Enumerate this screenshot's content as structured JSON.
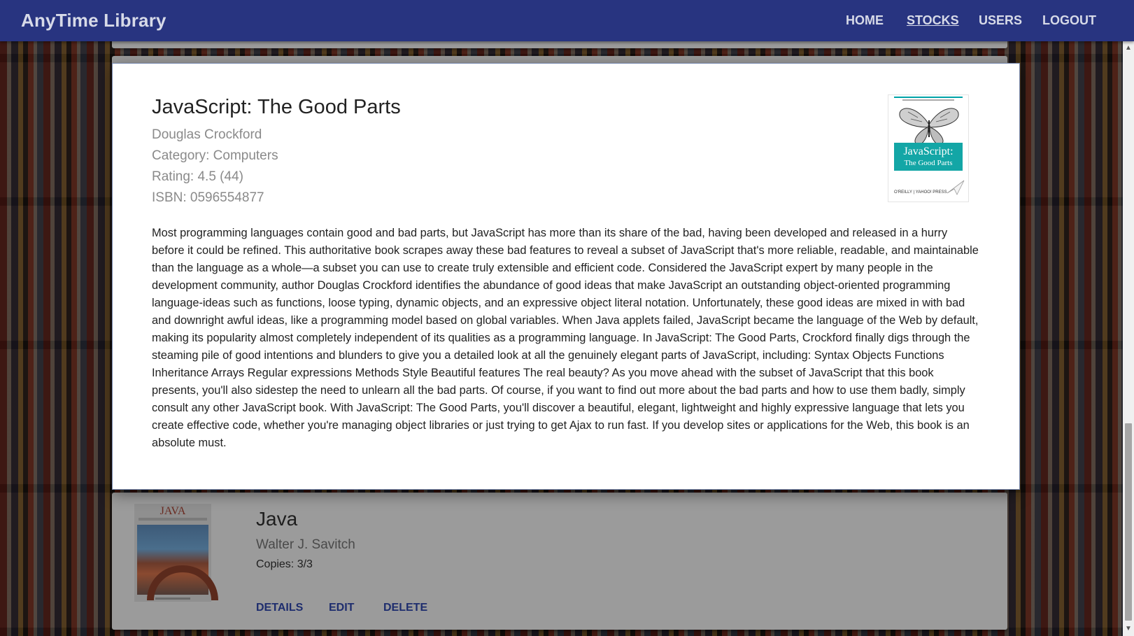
{
  "app": {
    "title": "AnyTime Library"
  },
  "nav": {
    "home": "HOME",
    "stocks": "STOCKS",
    "users": "USERS",
    "logout": "LOGOUT"
  },
  "modal": {
    "title": "JavaScript: The Good Parts",
    "author": "Douglas Crockford",
    "category": "Category: Computers",
    "rating": "Rating: 4.5 (44)",
    "isbn": "ISBN: 0596554877",
    "description": "Most programming languages contain good and bad parts, but JavaScript has more than its share of the bad, having been developed and released in a hurry before it could be refined. This authoritative book scrapes away these bad features to reveal a subset of JavaScript that's more reliable, readable, and maintainable than the language as a whole—a subset you can use to create truly extensible and efficient code. Considered the JavaScript expert by many people in the development community, author Douglas Crockford identifies the abundance of good ideas that make JavaScript an outstanding object-oriented programming language-ideas such as functions, loose typing, dynamic objects, and an expressive object literal notation. Unfortunately, these good ideas are mixed in with bad and downright awful ideas, like a programming model based on global variables. When Java applets failed, JavaScript became the language of the Web by default, making its popularity almost completely independent of its qualities as a programming language. In JavaScript: The Good Parts, Crockford finally digs through the steaming pile of good intentions and blunders to give you a detailed look at all the genuinely elegant parts of JavaScript, including: Syntax Objects Functions Inheritance Arrays Regular expressions Methods Style Beautiful features The real beauty? As you move ahead with the subset of JavaScript that this book presents, you'll also sidestep the need to unlearn all the bad parts. Of course, if you want to find out more about the bad parts and how to use them badly, simply consult any other JavaScript book. With JavaScript: The Good Parts, you'll discover a beautiful, elegant, lightweight and highly expressive language that lets you create effective code, whether you're managing object libraries or just trying to get Ajax to run fast. If you develop sites or applications for the Web, this book is an absolute must.",
    "cover": {
      "title_line1": "JavaScript:",
      "title_line2": "The Good Parts",
      "publisher": "O'REILLY | YAHOO! PRESS",
      "accent_color": "#13a6a6"
    }
  },
  "book_card": {
    "title": "Java",
    "author": "Walter J. Savitch",
    "copies": "Copies: 3/3",
    "cover_title": "JAVA",
    "actions": {
      "details": "DETAILS",
      "edit": "EDIT",
      "delete": "DELETE"
    }
  },
  "colors": {
    "navbar": "#283480",
    "action_text": "#1e2d6e"
  }
}
